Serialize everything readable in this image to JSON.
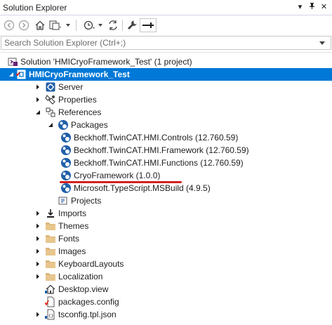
{
  "window": {
    "title": "Solution Explorer",
    "controls": [
      "▾",
      "ᴘ",
      "✕"
    ]
  },
  "search": {
    "placeholder": "Search Solution Explorer (Ctrl+;)"
  },
  "tree": [
    {
      "label": "Solution 'HMICryoFramework_Test' (1 project)",
      "icon": "solution-icon",
      "depth": 0,
      "expander": "none"
    },
    {
      "label": "HMICryoFramework_Test",
      "icon": "project-icon",
      "depth": 0,
      "expander": "expanded",
      "selected": true
    },
    {
      "label": "Server",
      "icon": "server-icon",
      "depth": 1,
      "expander": "collapsed"
    },
    {
      "label": "Properties",
      "icon": "properties-icon",
      "depth": 1,
      "expander": "collapsed"
    },
    {
      "label": "References",
      "icon": "references-icon",
      "depth": 1,
      "expander": "expanded"
    },
    {
      "label": "Packages",
      "icon": "package-icon",
      "depth": 2,
      "expander": "expanded"
    },
    {
      "label": "Beckhoff.TwinCAT.HMI.Controls (12.760.59)",
      "icon": "package-icon",
      "depth": 3,
      "expander": "none"
    },
    {
      "label": "Beckhoff.TwinCAT.HMI.Framework (12.760.59)",
      "icon": "package-icon",
      "depth": 3,
      "expander": "none"
    },
    {
      "label": "Beckhoff.TwinCAT.HMI.Functions (12.760.59)",
      "icon": "package-icon",
      "depth": 3,
      "expander": "none"
    },
    {
      "label": "CryoFramework (1.0.0)",
      "icon": "package-icon",
      "depth": 3,
      "expander": "none",
      "underlined": true
    },
    {
      "label": "Microsoft.TypeScript.MSBuild (4.9.5)",
      "icon": "package-icon",
      "depth": 3,
      "expander": "none"
    },
    {
      "label": "Projects",
      "icon": "projects-icon",
      "depth": 2,
      "expander": "none"
    },
    {
      "label": "Imports",
      "icon": "imports-icon",
      "depth": 1,
      "expander": "collapsed"
    },
    {
      "label": "Themes",
      "icon": "folder-icon",
      "depth": 1,
      "expander": "collapsed"
    },
    {
      "label": "Fonts",
      "icon": "folder-icon",
      "depth": 1,
      "expander": "collapsed"
    },
    {
      "label": "Images",
      "icon": "folder-icon",
      "depth": 1,
      "expander": "collapsed"
    },
    {
      "label": "KeyboardLayouts",
      "icon": "folder-icon",
      "depth": 1,
      "expander": "collapsed"
    },
    {
      "label": "Localization",
      "icon": "folder-icon",
      "depth": 1,
      "expander": "collapsed"
    },
    {
      "label": "Desktop.view",
      "icon": "home-view-icon",
      "depth": 1,
      "expander": "none"
    },
    {
      "label": "packages.config",
      "icon": "config-file-icon",
      "depth": 1,
      "expander": "none"
    },
    {
      "label": "tsconfig.tpl.json",
      "icon": "json-file-icon",
      "depth": 1,
      "expander": "collapsed"
    }
  ],
  "colors": {
    "selection": "#0078d7",
    "folder": "#dcb67a",
    "package": "#1f5fa8",
    "underline": "#d42020"
  }
}
